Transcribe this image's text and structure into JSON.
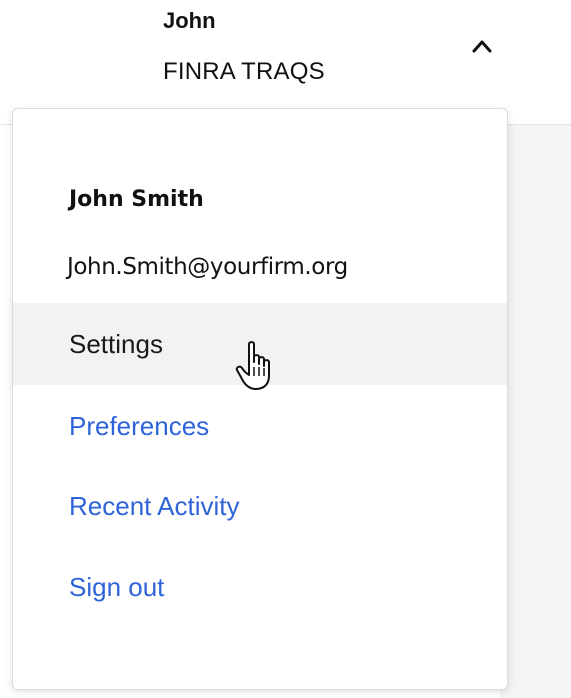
{
  "header": {
    "user_short_name": "John",
    "org_name": "FINRA TRAQS",
    "toggle_icon": "chevron-up-icon"
  },
  "menu": {
    "user_full_name": "John Smith",
    "user_email": "John.Smith@yourfirm.org",
    "items": [
      {
        "label": "Settings",
        "state": "hovered"
      },
      {
        "label": "Preferences"
      },
      {
        "label": "Recent Activity"
      },
      {
        "label": "Sign out"
      }
    ]
  },
  "cursor": "hand-pointer-icon",
  "colors": {
    "link": "#2f64d9",
    "hover_bg": "#f2f2f2",
    "text": "#111111",
    "backdrop": "#f4f4f4"
  }
}
